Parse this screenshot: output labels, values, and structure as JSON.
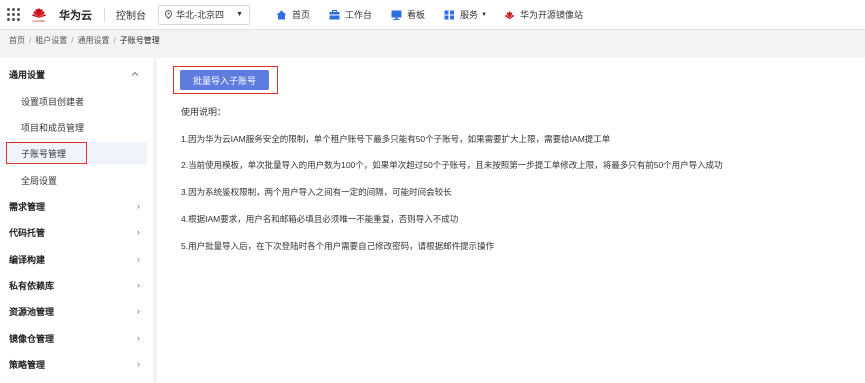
{
  "header": {
    "logo_text": "HUAWEI",
    "brand": "华为云",
    "console": "控制台",
    "region": "华北-北京四",
    "nav": [
      {
        "label": "首页",
        "icon": "home-icon"
      },
      {
        "label": "工作台",
        "icon": "workbench-icon"
      },
      {
        "label": "看板",
        "icon": "board-icon"
      },
      {
        "label": "服务",
        "icon": "service-icon"
      },
      {
        "label": "华为开源镜像站",
        "icon": "mirror-icon"
      }
    ],
    "colors": {
      "accent": "#c7000b",
      "nav_icon": "#2f6fe0"
    }
  },
  "breadcrumb": {
    "items": [
      "首页",
      "租户设置",
      "通用设置",
      "子账号管理"
    ],
    "sep": "/"
  },
  "sidebar": {
    "groups": [
      {
        "label": "通用设置",
        "expanded": true,
        "items": [
          "设置项目创建者",
          "项目和成员管理",
          "子账号管理",
          "全局设置"
        ]
      },
      {
        "label": "需求管理"
      },
      {
        "label": "代码托管"
      },
      {
        "label": "编译构建"
      },
      {
        "label": "私有依赖库"
      },
      {
        "label": "资源池管理"
      },
      {
        "label": "镜像仓管理"
      },
      {
        "label": "策略管理"
      }
    ],
    "active_item": "子账号管理"
  },
  "main": {
    "import_button": "批量导入子账号",
    "usage_title": "使用说明：",
    "instructions": [
      "1.因为华为云IAM服务安全的限制，单个租户账号下最多只能有50个子账号，如果需要扩大上限，需要给IAM提工单",
      "2.当前使用模板，单次批量导入的用户数为100个，如果单次超过50个子账号，且未按照第一步提工单修改上限，将最多只有前50个用户导入成功",
      "3.因为系统鉴权限制，两个用户导入之间有一定的间隔，可能时间会较长",
      "4.根据IAM要求，用户名和邮箱必填且必须唯一不能重复，否则导入不成功",
      "5.用户批量导入后，在下次登陆时各个用户需要自己修改密码，请根据邮件提示操作"
    ],
    "colors": {
      "button": "#5e7ce0",
      "highlight": "#e0302a"
    }
  }
}
